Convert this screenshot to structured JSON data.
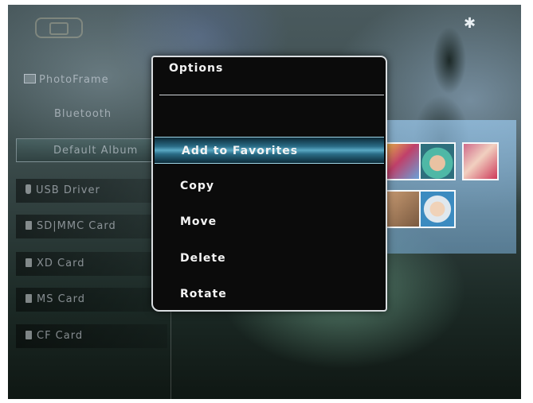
{
  "status_bar": {
    "frame_icon": "photoframe-status-icon",
    "bluetooth_icon": "bluetooth-icon",
    "bluetooth_glyph": "✱"
  },
  "left_menu": {
    "title": "PhotoFrame",
    "items": [
      {
        "label": "Bluetooth",
        "kind": "sub"
      },
      {
        "label": "Default Album",
        "kind": "sub",
        "selected": true
      },
      {
        "label": "USB Driver",
        "kind": "device",
        "icon": "usb-icon"
      },
      {
        "label": "SD|MMC Card",
        "kind": "device",
        "icon": "card-icon"
      },
      {
        "label": "XD Card",
        "kind": "device",
        "icon": "card-icon"
      },
      {
        "label": "MS Card",
        "kind": "device",
        "icon": "card-icon"
      },
      {
        "label": "CF Card",
        "kind": "device",
        "icon": "card-icon"
      }
    ]
  },
  "options_dialog": {
    "title": "Options",
    "items": [
      {
        "label": "Add to Favorites",
        "highlighted": true
      },
      {
        "label": "Copy"
      },
      {
        "label": "Move"
      },
      {
        "label": "Delete"
      },
      {
        "label": "Rotate"
      }
    ]
  },
  "colors": {
    "dialog_bg": "#0b0b0b",
    "highlight": "#5aa9c4",
    "border": "#d9dde0"
  }
}
